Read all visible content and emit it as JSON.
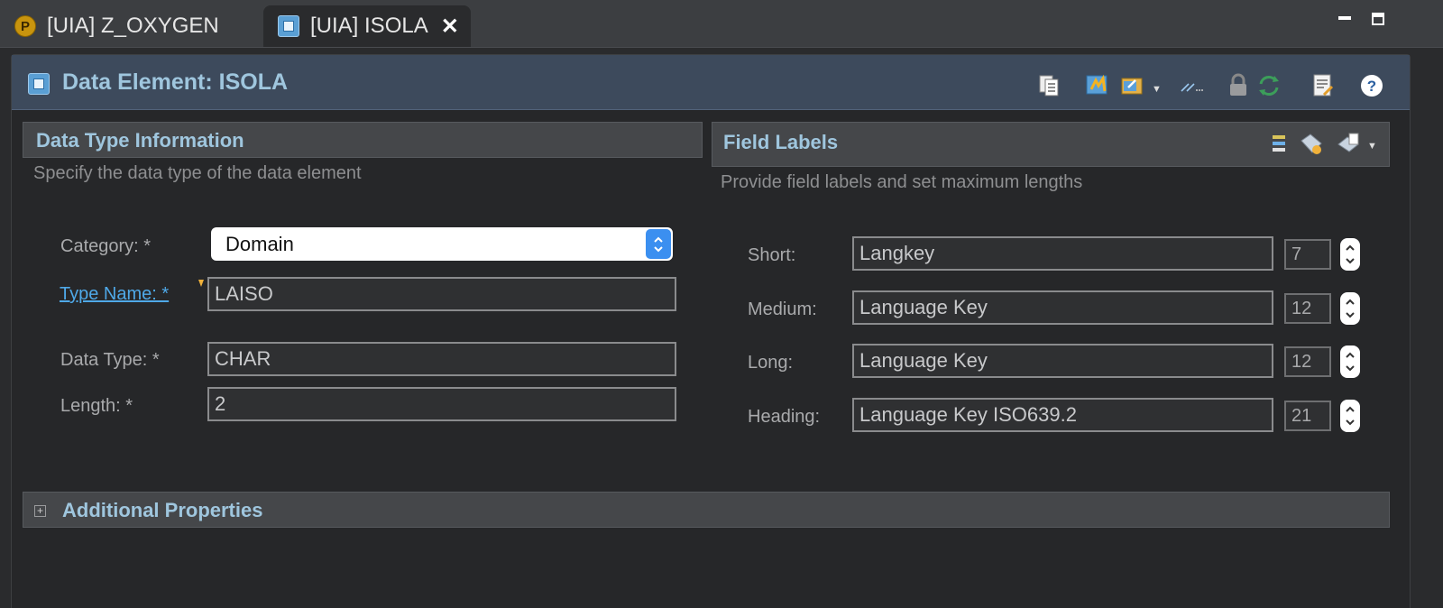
{
  "tabs": [
    {
      "label": "[UIA] Z_OXYGEN",
      "icon": "abap-package-icon",
      "badge": "P"
    },
    {
      "label": "[UIA] ISOLA",
      "icon": "data-element-icon"
    }
  ],
  "editor": {
    "title": "Data Element: ISOLA",
    "toolbar_icons": [
      "copy-icon",
      "activate-icon",
      "open-in-icon",
      "where-used-icon",
      "lock-icon",
      "refresh-icon",
      "properties-icon",
      "help-icon"
    ]
  },
  "data_type": {
    "title": "Data Type Information",
    "description": "Specify the data type of the data element",
    "category_label": "Category: *",
    "category_value": "Domain",
    "type_name_label": "Type Name: *",
    "type_name_value": "LAISO",
    "data_type_label": "Data Type: *",
    "data_type_value": "CHAR",
    "length_label": "Length: *",
    "length_value": "2"
  },
  "field_labels": {
    "title": "Field Labels",
    "description": "Provide field labels and set maximum lengths",
    "rows": [
      {
        "label": "Short:",
        "value": "Langkey",
        "max": "7"
      },
      {
        "label": "Medium:",
        "value": "Language Key",
        "max": "12"
      },
      {
        "label": "Long:",
        "value": "Language Key",
        "max": "12"
      },
      {
        "label": "Heading:",
        "value": "Language Key ISO639.2",
        "max": "21"
      }
    ]
  },
  "additional": {
    "title": "Additional Properties",
    "expand_symbol": "+"
  },
  "colors": {
    "section_title": "#9fc6de",
    "link": "#4fa9e8",
    "header_bg": "#3d4a5c",
    "select_button": "#3b8ff0"
  }
}
